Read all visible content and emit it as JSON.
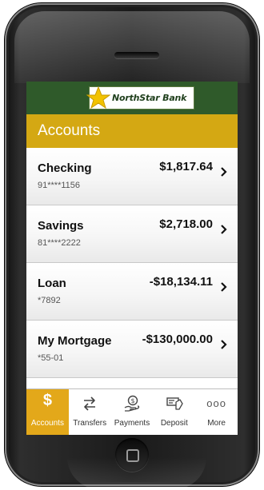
{
  "app": {
    "bank_name": "NorthStar Bank",
    "screen_title": "Accounts",
    "brand_color": "#2f5a2a",
    "accent_color": "#d4a813"
  },
  "accounts": [
    {
      "name": "Checking",
      "number": "91****1156",
      "balance": "$1,817.64"
    },
    {
      "name": "Savings",
      "number": "81****2222",
      "balance": "$2,718.00"
    },
    {
      "name": "Loan",
      "number": "*7892",
      "balance": "-$18,134.11"
    },
    {
      "name": "My Mortgage",
      "number": "*55-01",
      "balance": "-$130,000.00"
    }
  ],
  "tabs": [
    {
      "label": "Accounts",
      "icon": "dollar-icon",
      "active": true
    },
    {
      "label": "Transfers",
      "icon": "transfer-arrows-icon",
      "active": false
    },
    {
      "label": "Payments",
      "icon": "payment-hand-icon",
      "active": false
    },
    {
      "label": "Deposit",
      "icon": "check-deposit-icon",
      "active": false
    },
    {
      "label": "More",
      "icon": "more-dots-icon",
      "active": false
    }
  ],
  "icons": {
    "accounts_glyph": "$",
    "more_glyph": "ooo"
  }
}
